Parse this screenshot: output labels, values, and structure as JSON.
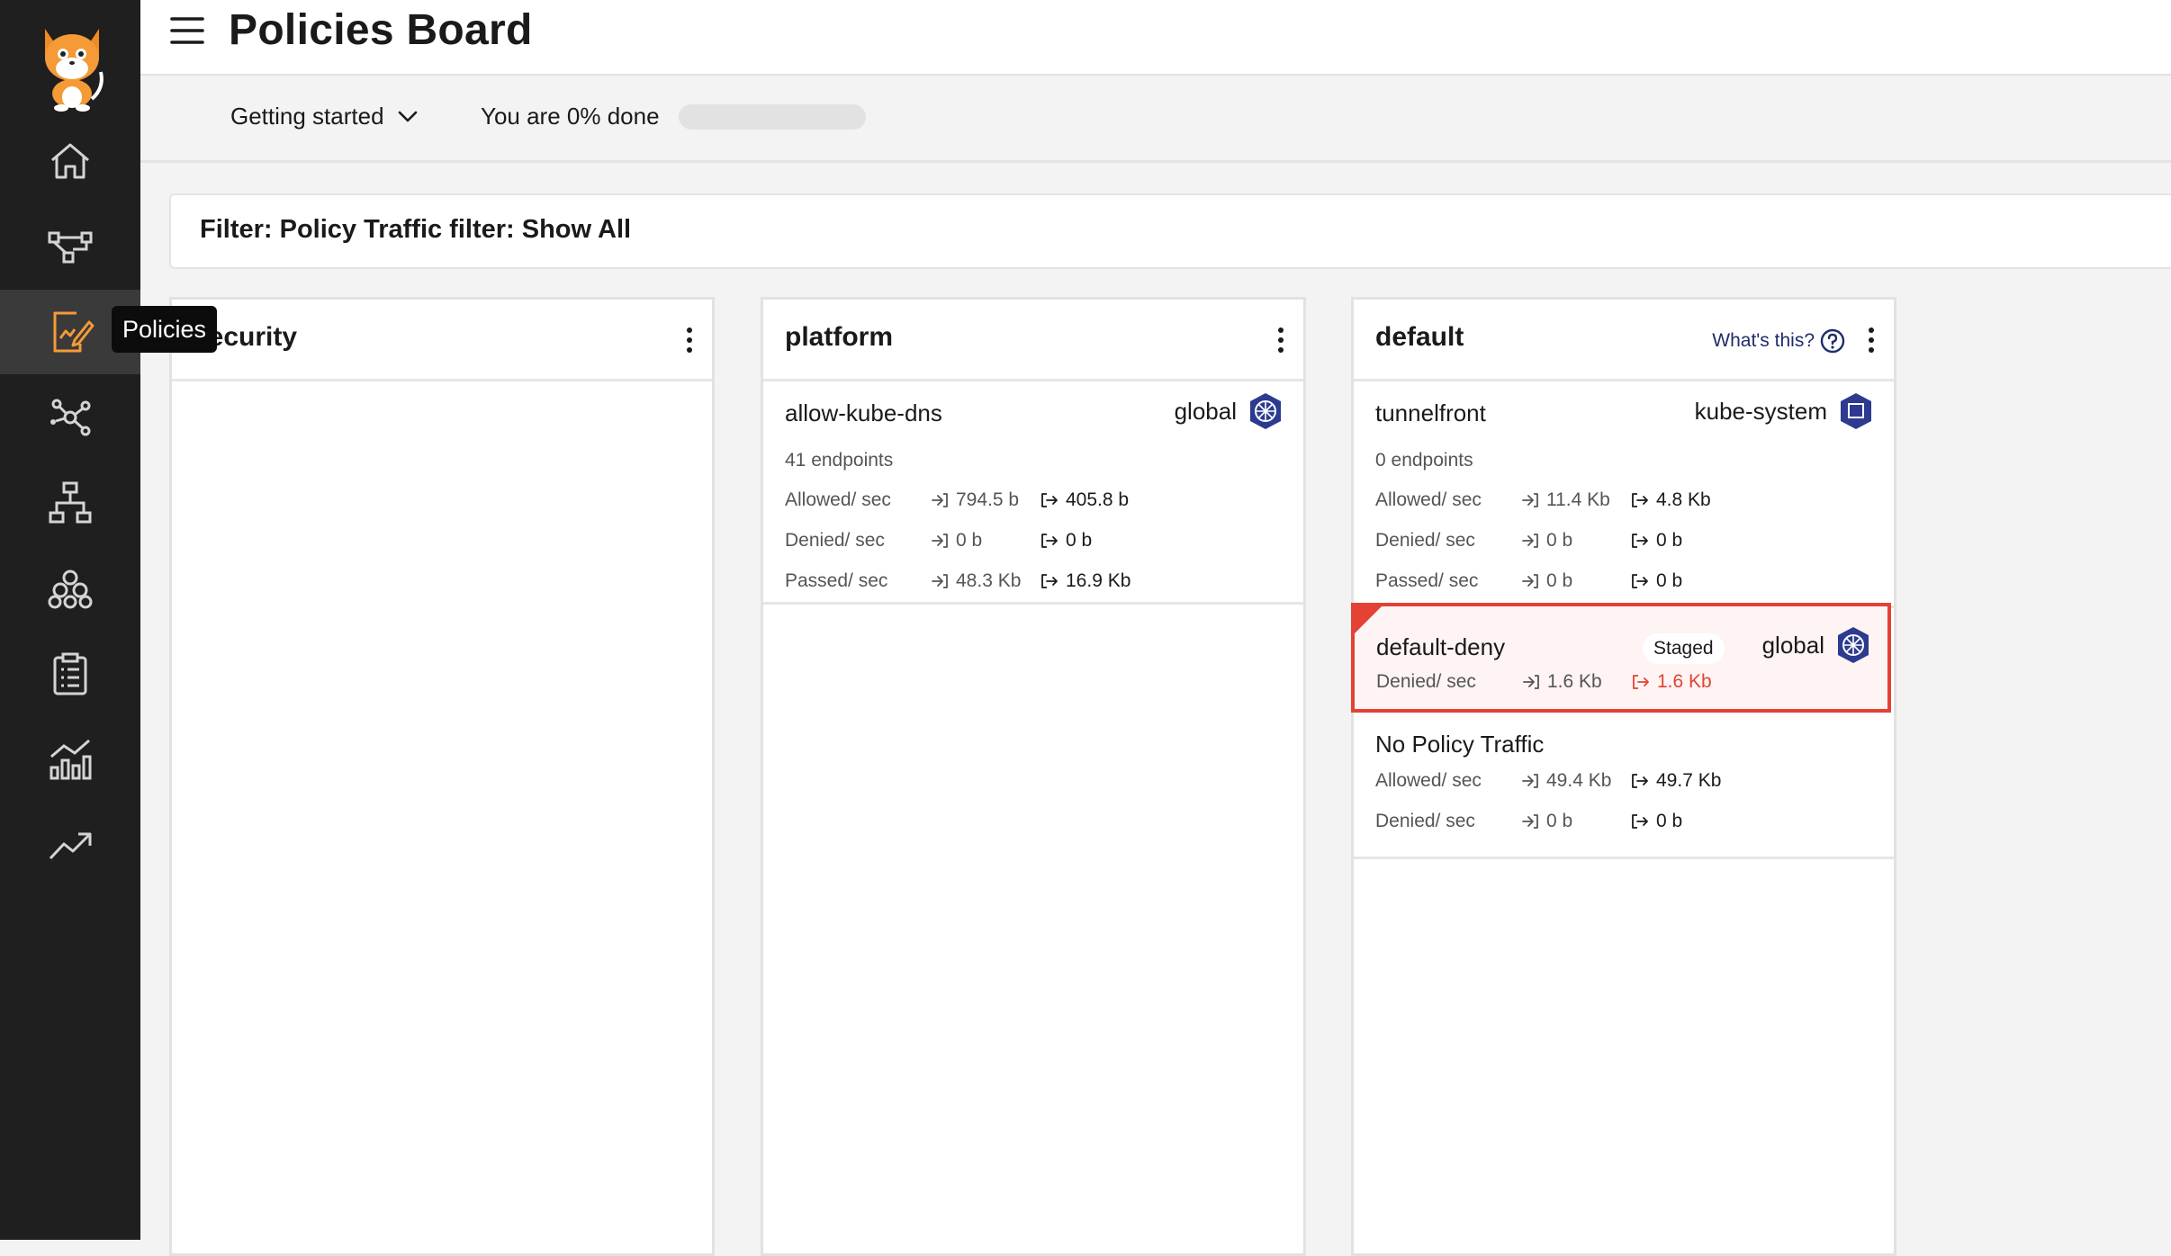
{
  "app": {
    "title": "Policies Board"
  },
  "sidebar": {
    "items": [
      {
        "icon": "home-icon"
      },
      {
        "icon": "service-graph-icon"
      },
      {
        "icon": "policies-icon",
        "active": true
      },
      {
        "icon": "network-nodes-icon"
      },
      {
        "icon": "endpoints-hierarchy-icon"
      },
      {
        "icon": "clusters-icon"
      },
      {
        "icon": "clipboard-list-icon"
      },
      {
        "icon": "dashboard-chart-icon"
      },
      {
        "icon": "trend-up-icon"
      }
    ],
    "tooltip": "Policies"
  },
  "subbar": {
    "getting_started": "Getting started",
    "progress_text": "You are 0% done",
    "progress_percent": 0
  },
  "filter": {
    "text": "Filter: Policy Traffic filter: Show All"
  },
  "columns": [
    {
      "title": "security"
    },
    {
      "title": "platform",
      "cards": [
        {
          "name": "allow-kube-dns",
          "namespace": "global",
          "endpoints": "41 endpoints",
          "rows": [
            {
              "label": "Allowed/ sec",
              "in": "794.5 b",
              "out": "405.8 b"
            },
            {
              "label": "Denied/ sec",
              "in": "0 b",
              "out": "0 b"
            },
            {
              "label": "Passed/ sec",
              "in": "48.3 Kb",
              "out": "16.9 Kb"
            }
          ]
        }
      ]
    },
    {
      "title": "default",
      "whats_this": "What's this?",
      "cards": [
        {
          "name": "tunnelfront",
          "namespace": "kube-system",
          "endpoints": "0 endpoints",
          "rows": [
            {
              "label": "Allowed/ sec",
              "in": "11.4 Kb",
              "out": "4.8 Kb"
            },
            {
              "label": "Denied/ sec",
              "in": "0 b",
              "out": "0 b"
            },
            {
              "label": "Passed/ sec",
              "in": "0 b",
              "out": "0 b"
            }
          ]
        },
        {
          "name": "default-deny",
          "badge": "Staged",
          "namespace": "global",
          "rows": [
            {
              "label": "Denied/ sec",
              "in": "1.6 Kb",
              "out": "1.6 Kb"
            }
          ]
        },
        {
          "name": "No Policy Traffic",
          "rows": [
            {
              "label": "Allowed/ sec",
              "in": "49.4 Kb",
              "out": "49.7 Kb"
            },
            {
              "label": "Denied/ sec",
              "in": "0 b",
              "out": "0 b"
            }
          ]
        }
      ]
    }
  ],
  "colors": {
    "accent": "#f59a36",
    "staged_border": "#e34234",
    "namespace_badge": "#2c3b8f"
  }
}
